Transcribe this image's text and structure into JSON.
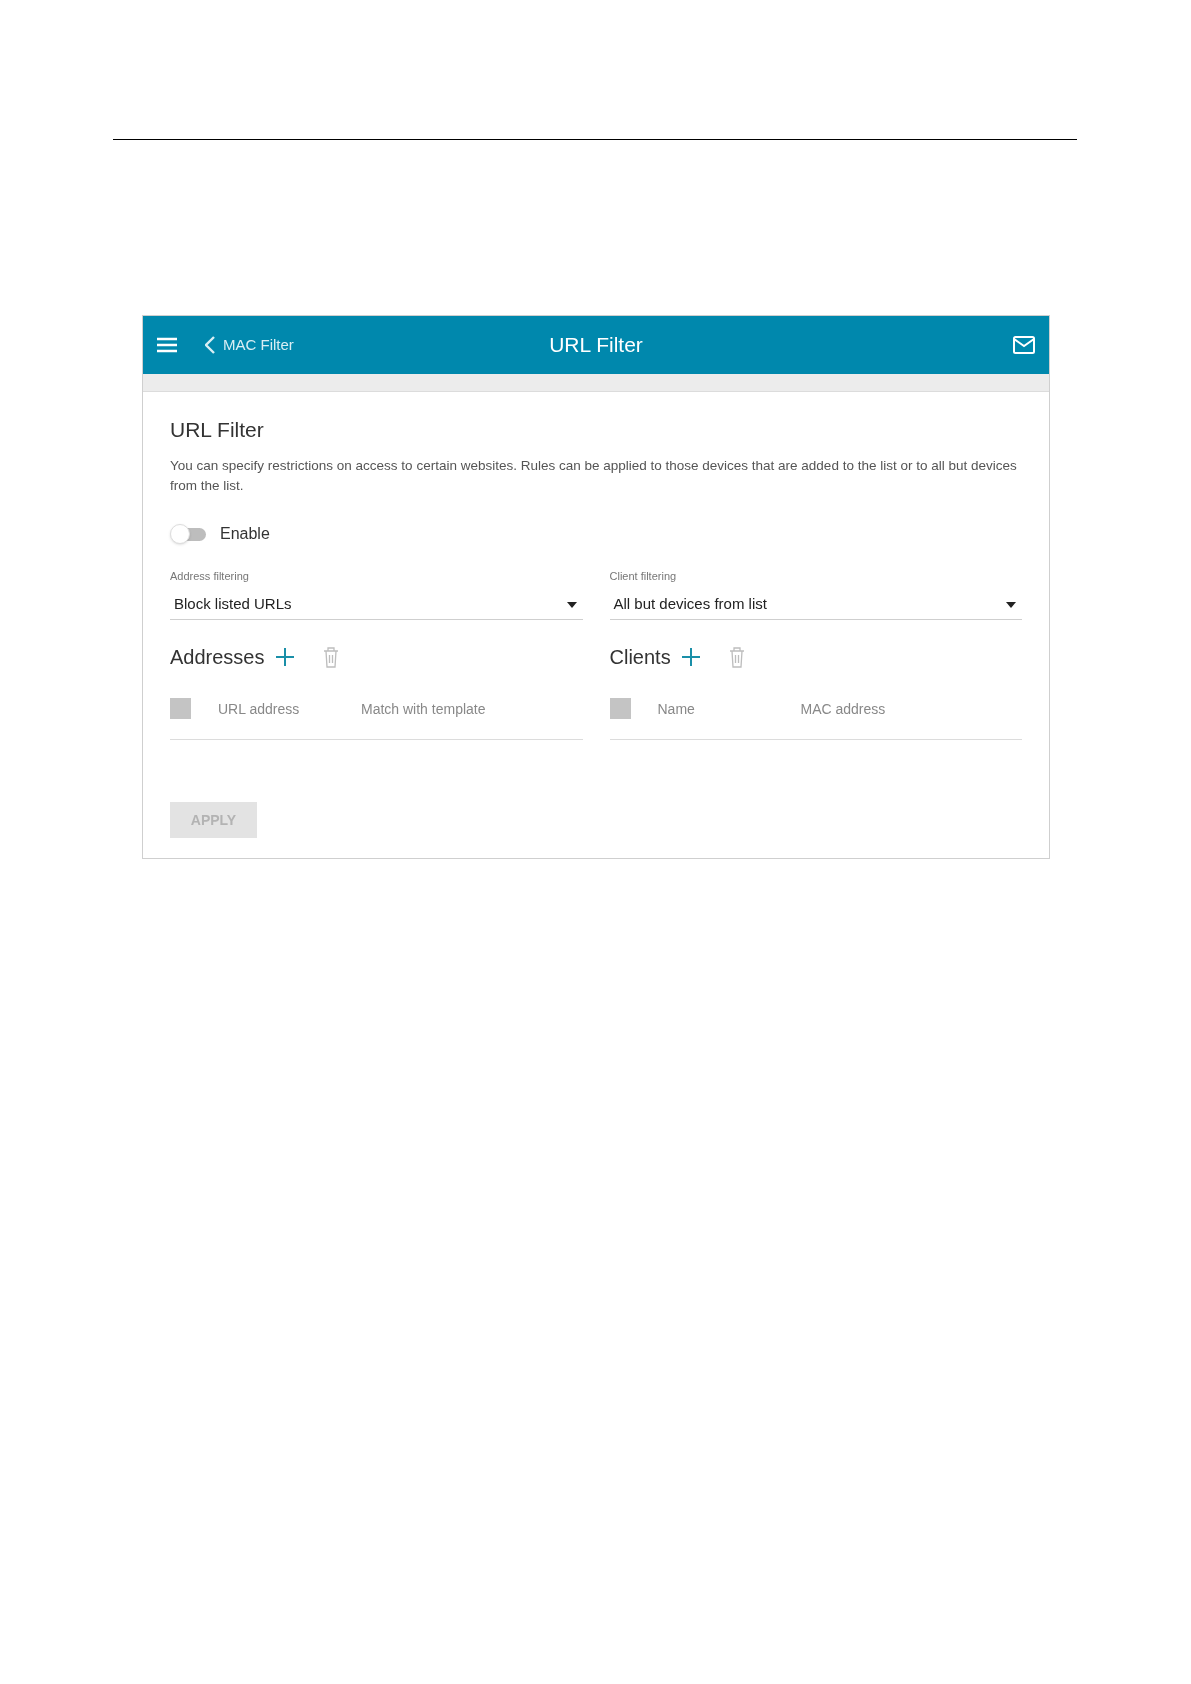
{
  "header": {
    "back_label": "MAC Filter",
    "title": "URL Filter"
  },
  "section": {
    "title": "URL Filter",
    "description": "You can specify restrictions on access to certain websites. Rules can be applied to those devices that are added to the list or to all but devices from the list."
  },
  "enable": {
    "label": "Enable",
    "on": false
  },
  "selects": [
    {
      "label": "Address filtering",
      "value": "Block listed URLs"
    },
    {
      "label": "Client filtering",
      "value": "All but devices from list"
    }
  ],
  "lists": [
    {
      "title": "Addresses",
      "checked": false,
      "columns": [
        "URL address",
        "Match with template"
      ]
    },
    {
      "title": "Clients",
      "checked": false,
      "columns": [
        "Name",
        "MAC address"
      ]
    }
  ],
  "apply": {
    "label": "APPLY",
    "disabled": true
  }
}
